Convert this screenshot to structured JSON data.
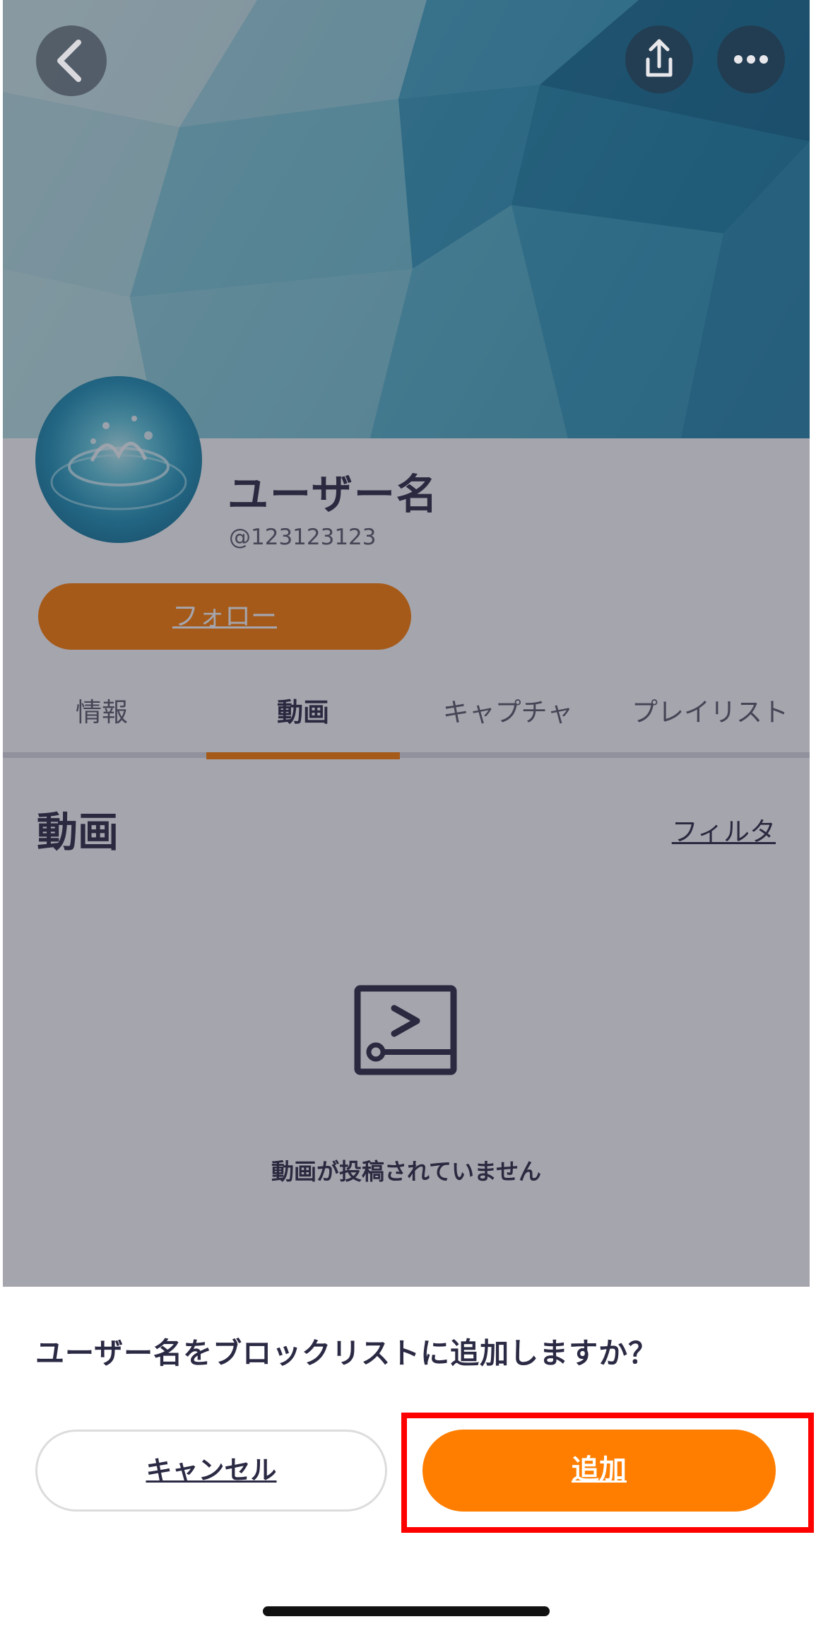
{
  "profile": {
    "user_name": "ユーザー名",
    "handle": "@123123123",
    "follow_label": "フォロー"
  },
  "tabs": [
    {
      "label": "情報",
      "active": false
    },
    {
      "label": "動画",
      "active": true
    },
    {
      "label": "キャプチャ",
      "active": false
    },
    {
      "label": "プレイリスト",
      "active": false
    }
  ],
  "videos": {
    "section_title": "動画",
    "filter_label": "フィルタ",
    "empty_message": "動画が投稿されていません"
  },
  "dialog": {
    "question": "ユーザー名をブロックリストに追加しますか？",
    "cancel_label": "キャンセル",
    "add_label": "追加"
  },
  "icons": {
    "back": "chevron-left-icon",
    "share": "share-icon",
    "more": "more-dots-icon",
    "empty_video": "video-empty-icon"
  },
  "colors": {
    "accent": "#ff7e00",
    "text_primary": "#2b2a44",
    "highlight": "#ff0000"
  }
}
